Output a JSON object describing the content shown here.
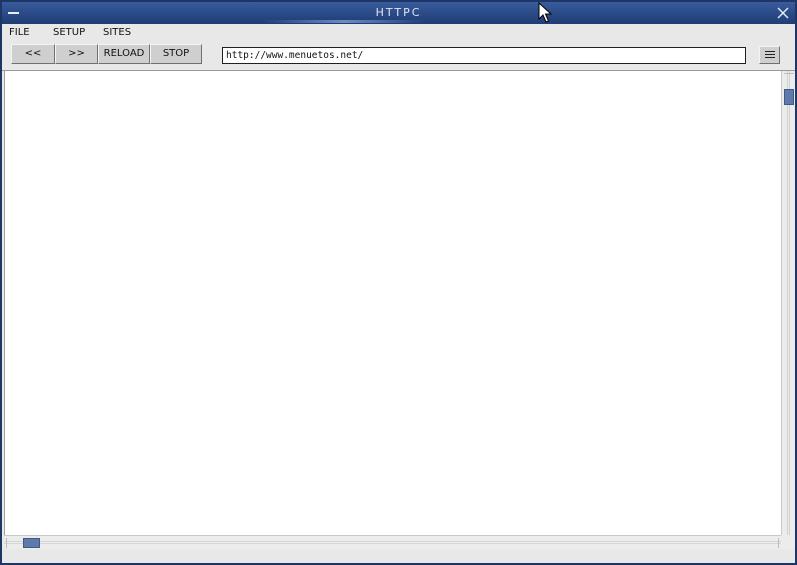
{
  "window": {
    "title": "HTTPC"
  },
  "menubar": {
    "items": [
      "FILE",
      "SETUP",
      "SITES"
    ]
  },
  "toolbar": {
    "back_label": "<<",
    "forward_label": ">>",
    "reload_label": "RELOAD",
    "stop_label": "STOP",
    "url_value": "http://www.menuetos.net/",
    "menu_icon": "hamburger-menu-icon"
  },
  "colors": {
    "titlebar": "#2a4a86",
    "window_bg": "#e8e8e8",
    "button_face": "#cfcfcf",
    "scroll_thumb": "#5f7aa8",
    "content_bg": "#ffffff"
  },
  "icons": {
    "minimize": "minimize-icon",
    "close": "close-icon",
    "cursor": "mouse-pointer-icon"
  }
}
